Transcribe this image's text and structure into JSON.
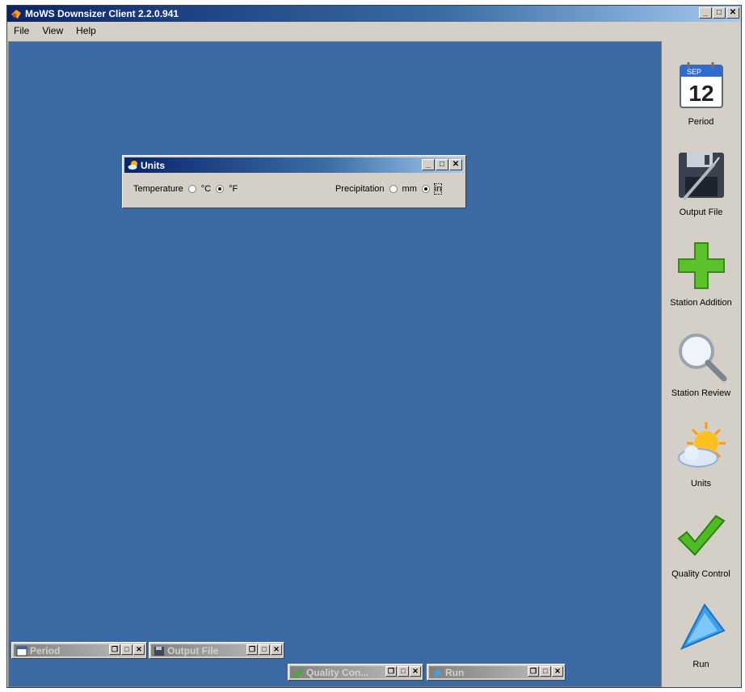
{
  "app": {
    "title": "MoWS Downsizer Client 2.2.0.941",
    "controls": {
      "minimize": "_",
      "maximize": "□",
      "close": "✕"
    }
  },
  "menu": {
    "items": [
      "File",
      "View",
      "Help"
    ]
  },
  "toolbar": {
    "calendar_icon_month": "SEP",
    "calendar_icon_day": "12",
    "items": [
      {
        "label": "Period",
        "icon": "calendar-icon"
      },
      {
        "label": "Output File",
        "icon": "floppy-disk-icon"
      },
      {
        "label": "Station Addition",
        "icon": "plus-icon"
      },
      {
        "label": "Station Review",
        "icon": "magnifier-icon"
      },
      {
        "label": "Units",
        "icon": "sun-cloud-icon"
      },
      {
        "label": "Quality Control",
        "icon": "checkmark-icon"
      },
      {
        "label": "Run",
        "icon": "play-triangle-icon"
      }
    ]
  },
  "units_window": {
    "title": "Units",
    "temperature": {
      "label": "Temperature",
      "options": [
        "°C",
        "°F"
      ],
      "selected": "°F"
    },
    "precipitation": {
      "label": "Precipitation",
      "options": [
        "mm",
        "in"
      ],
      "selected": "in"
    }
  },
  "minimized_windows": [
    {
      "title": "Period",
      "icon": "calendar-icon"
    },
    {
      "title": "Output File",
      "icon": "floppy-disk-icon"
    },
    {
      "title": "Quality Con...",
      "icon": "checkmark-icon"
    },
    {
      "title": "Run",
      "icon": "play-triangle-icon"
    }
  ],
  "colors": {
    "mdi_background": "#3a69a4",
    "titlebar_active": "#0a246a",
    "chrome": "#d4d0c8"
  }
}
